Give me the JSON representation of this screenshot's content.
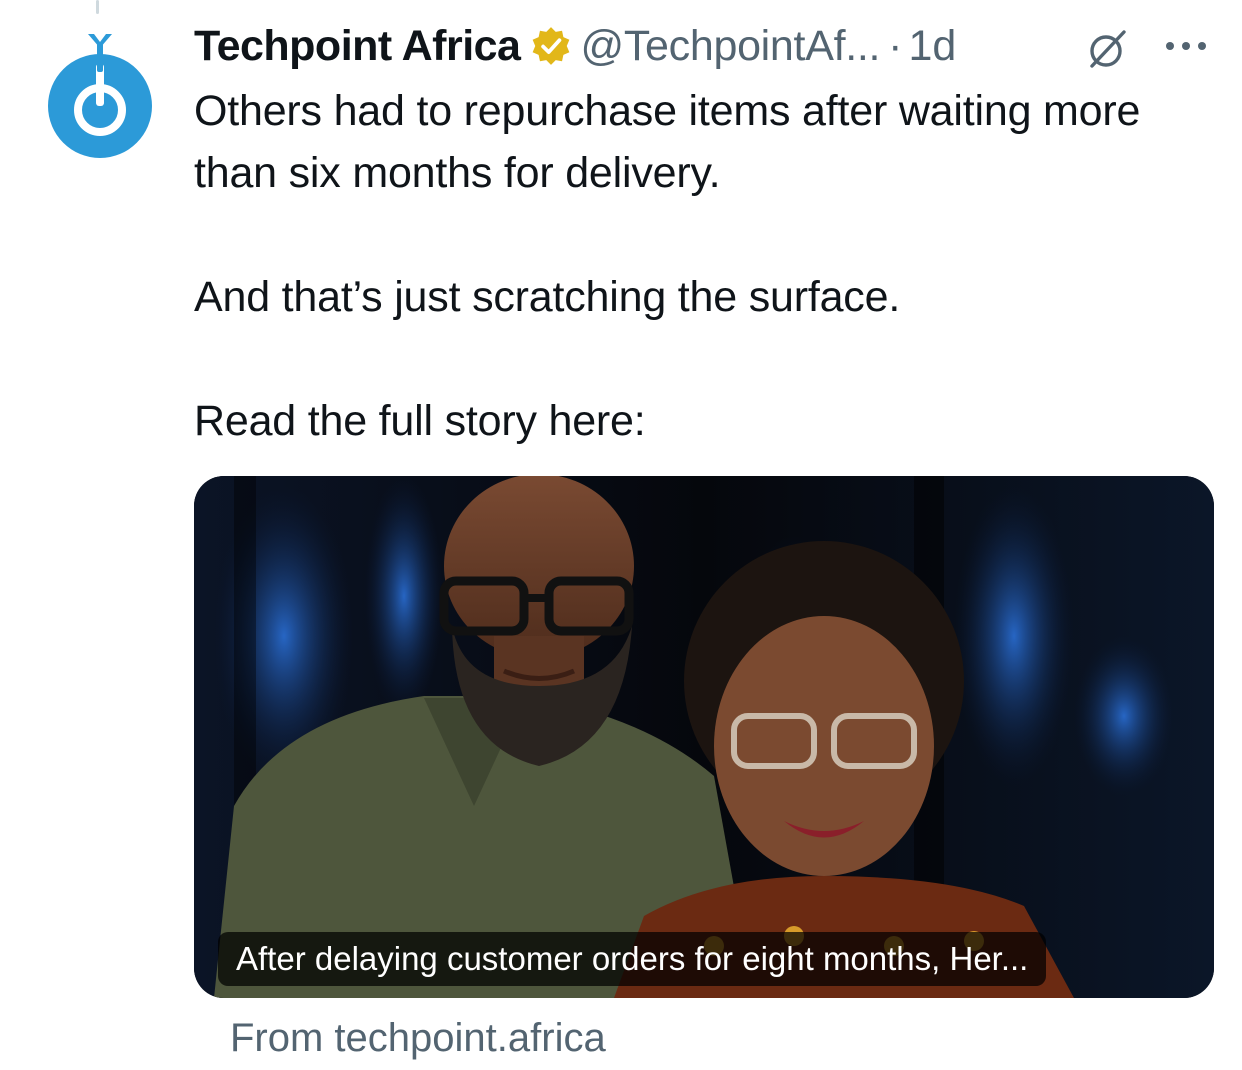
{
  "tweet": {
    "display_name": "Techpoint Africa",
    "verified": true,
    "verified_icon": "verified-badge-gold-icon",
    "handle": "@TechpointAf...",
    "separator": "·",
    "time": "1d",
    "grok_icon": "grok-slash-icon",
    "more_icon": "more-horizontal-icon",
    "text": "Others had to repurchase items after waiting more than six months for delivery.\n\nAnd that’s just scratching the surface.\n\nRead the full story here:"
  },
  "card": {
    "caption": "After delaying customer orders for eight months, Her...",
    "source": "From techpoint.africa"
  },
  "colors": {
    "brand_blue": "#2c9ad8",
    "verified_gold": "#e2b719",
    "secondary_text": "#536471"
  }
}
